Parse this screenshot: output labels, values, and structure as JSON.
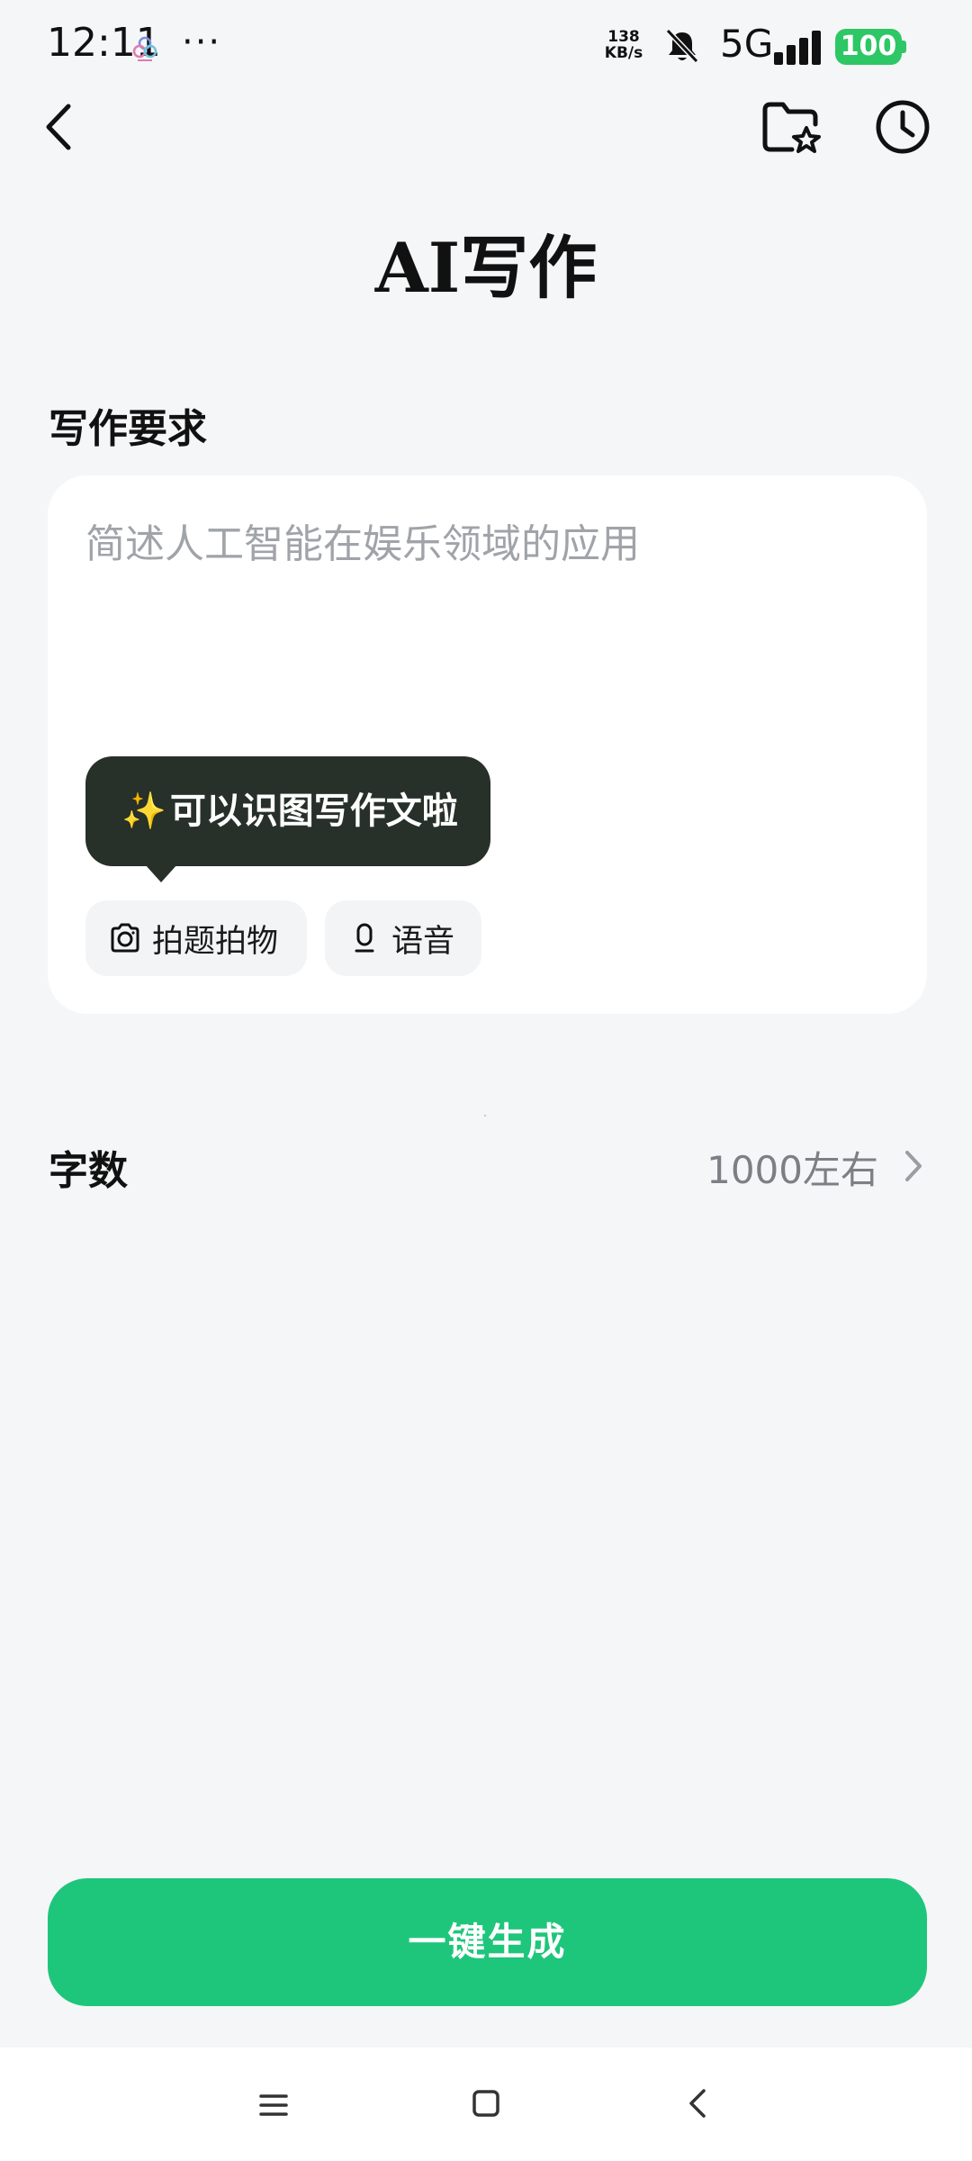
{
  "status_bar": {
    "time": "12:11",
    "more_dots": "···",
    "speed_value": "138",
    "speed_unit": "KB/s",
    "network": "5G",
    "battery": "100",
    "battery_color": "#2ec765"
  },
  "header": {
    "title": "AI写作",
    "back_icon": "chevron-left-icon",
    "favorites_icon": "folder-star-icon",
    "history_icon": "clock-icon"
  },
  "requirements": {
    "section_label": "写作要求",
    "placeholder": "简述人工智能在娱乐领域的应用",
    "tooltip_sparkle": "✨",
    "tooltip_text": "可以识图写作文啦",
    "photo_button_label": "拍题拍物",
    "voice_button_label": "语音"
  },
  "word_count": {
    "label": "字数",
    "value": "1000左右"
  },
  "generate": {
    "label": "一键生成",
    "color": "#1ec67b"
  },
  "bottom_nav": {
    "menu_icon": "menu-icon",
    "home_icon": "square-home-icon",
    "back_icon": "triangle-back-icon"
  }
}
